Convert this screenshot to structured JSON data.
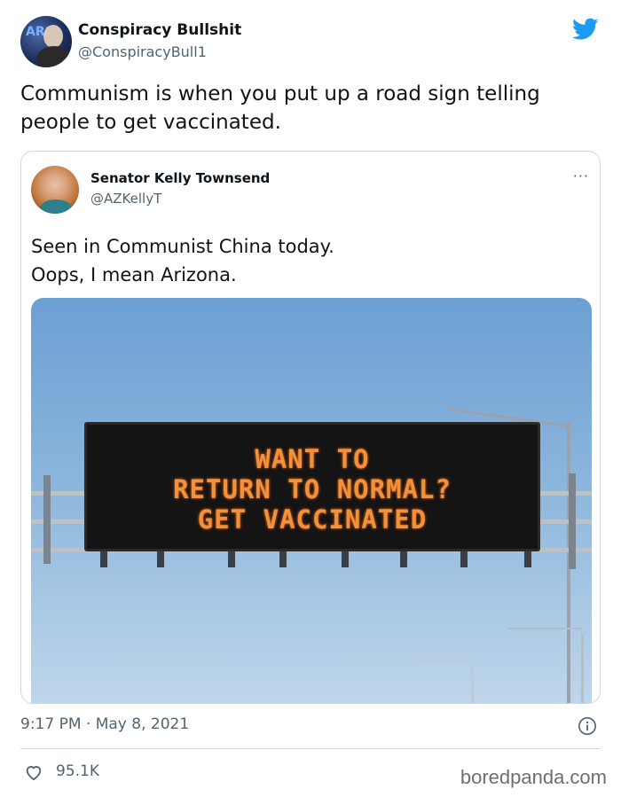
{
  "tweet": {
    "author_name": "Conspiracy Bullshit",
    "author_handle": "@ConspiracyBull1",
    "avatar_text": "ARS",
    "text": "Communism is when you put up a road sign telling people to get vaccinated.",
    "timestamp": "9:17 PM · May 8, 2021",
    "likes": "95.1K"
  },
  "quote": {
    "author_name": "Senator Kelly Townsend",
    "author_handle": "@AZKellyT",
    "more_label": "···",
    "text_line1": "Seen in Communist China today.",
    "text_line2": "Oops, I mean Arizona.",
    "sign_lines": [
      "WANT TO",
      "RETURN TO NORMAL?",
      "GET VACCINATED"
    ]
  },
  "watermark": "boredpanda.com",
  "colors": {
    "twitter_blue": "#1d9bf0",
    "secondary_text": "#536471",
    "sign_text": "#f0923a"
  },
  "icons": {
    "brand": "twitter-bird-icon",
    "info": "info-icon",
    "like": "heart-icon",
    "more": "ellipsis-icon"
  }
}
